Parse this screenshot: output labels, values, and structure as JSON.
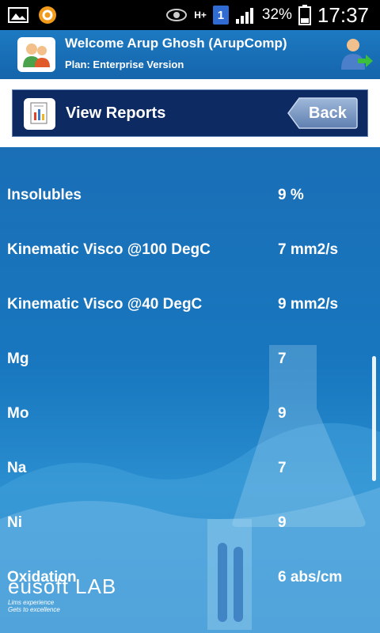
{
  "status_bar": {
    "battery_percent": "32%",
    "time": "17:37",
    "network_label": "H+",
    "notification_count": "1",
    "icons": [
      "gallery-icon",
      "sync-icon",
      "eye-icon",
      "signal-icon",
      "battery-icon"
    ]
  },
  "header": {
    "welcome": "Welcome Arup Ghosh (ArupComp)",
    "plan": "Plan: Enterprise Version",
    "icons": [
      "users-icon",
      "logout-icon"
    ]
  },
  "navbar": {
    "title": "View Reports",
    "back_label": "Back",
    "icon": "report-icon"
  },
  "results": [
    {
      "label": "Insolubles",
      "value": "9 %"
    },
    {
      "label": "Kinematic Visco @100 DegC",
      "value": "7 mm2/s"
    },
    {
      "label": "Kinematic Visco @40 DegC",
      "value": "9 mm2/s"
    },
    {
      "label": "Mg",
      "value": "7"
    },
    {
      "label": "Mo",
      "value": "9"
    },
    {
      "label": "Na",
      "value": "7"
    },
    {
      "label": "Ni",
      "value": "9"
    },
    {
      "label": "Oxidation",
      "value": "6 abs/cm"
    }
  ],
  "brand": {
    "name": "eusoft LAB",
    "tagline_1": "Lims experience",
    "tagline_2": "Gets to excellence"
  },
  "colors": {
    "status_bar_bg": "#000000",
    "header_bg": "#1a72ba",
    "nav_bg": "#0e2a63",
    "content_bg": "#1a6fb6",
    "text": "#ffffff"
  }
}
